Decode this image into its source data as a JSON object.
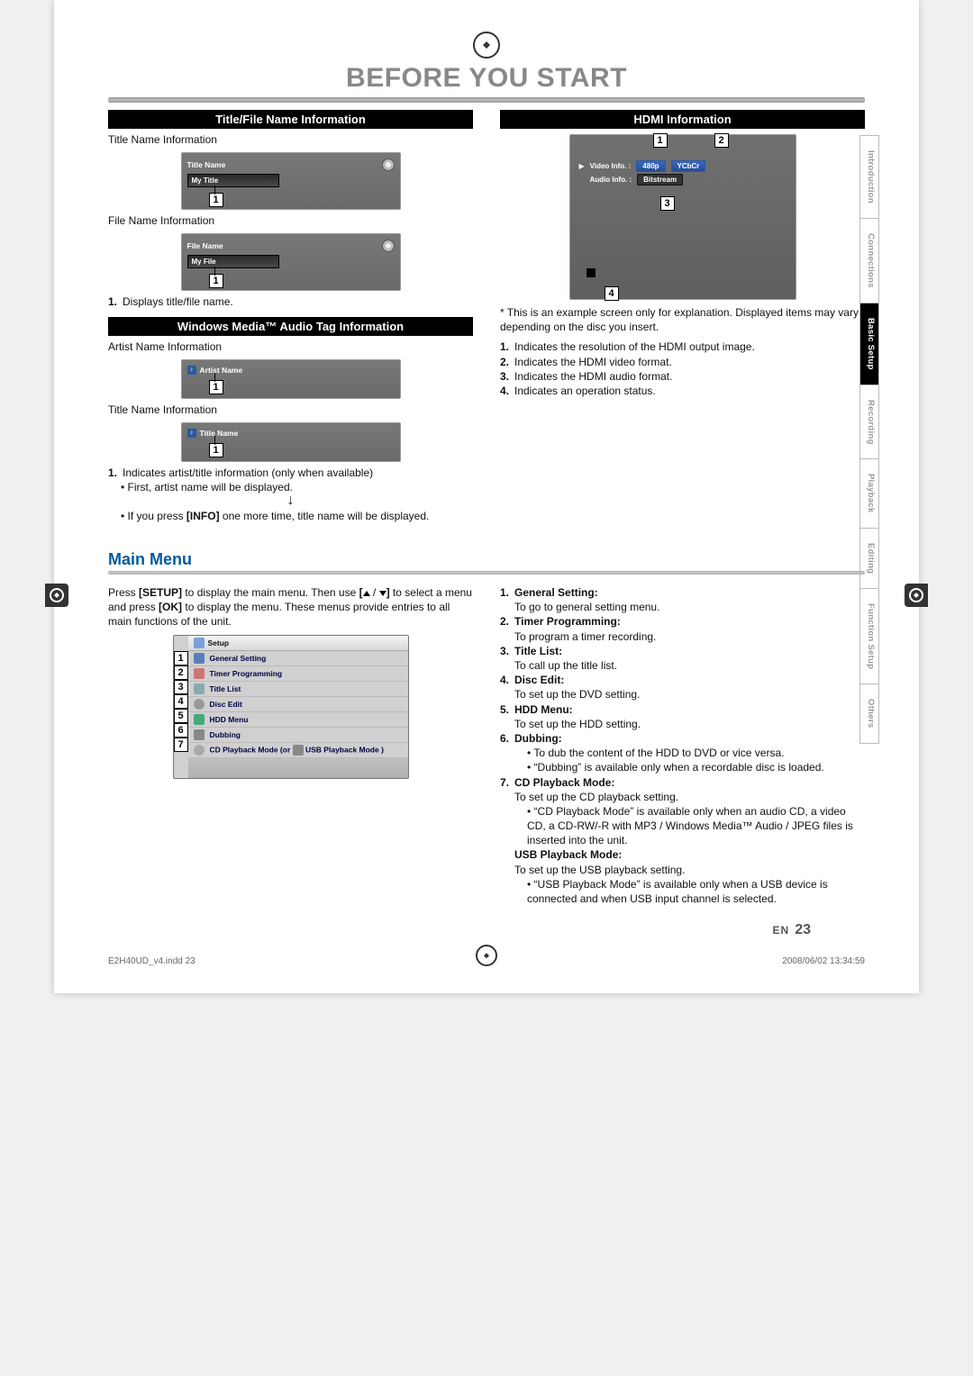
{
  "page": {
    "title": "BEFORE YOU START",
    "lang_code": "EN",
    "page_number": "23",
    "indd_file": "E2H40UD_v4.indd   23",
    "print_timestamp": "2008/06/02   13:34:59"
  },
  "tabs": [
    "Introduction",
    "Connections",
    "Basic Setup",
    "Recording",
    "Playback",
    "Editing",
    "Function Setup",
    "Others"
  ],
  "active_tab": "Basic Setup",
  "left": {
    "title_file_bar": "Title/File Name Information",
    "title_info_label": "Title Name Information",
    "shot_title_header": "Title Name",
    "shot_title_value": "My Title",
    "file_info_label": "File Name Information",
    "shot_file_header": "File Name",
    "shot_file_value": "My File",
    "callout_1_text": "Displays title/file name.",
    "wma_bar": "Windows Media™ Audio Tag Information",
    "artist_label": "Artist Name Information",
    "shot_artist_header": "Artist Name",
    "title2_label": "Title Name Information",
    "shot_title2_header": "Title Name",
    "wma_1_text": "Indicates artist/title information (only when available)",
    "wma_bullet_a": "First, artist name will be displayed.",
    "wma_bullet_b_pre": "If you press ",
    "wma_bullet_b_key": "[INFO]",
    "wma_bullet_b_post": " one more time, title name will be displayed."
  },
  "right": {
    "hdmi_bar": "HDMI Information",
    "hdmi_video_label": "Video Info.   :",
    "hdmi_video_res": "480p",
    "hdmi_video_fmt": "YCbCr",
    "hdmi_audio_label": "Audio Info.   :",
    "hdmi_audio_fmt": "Bitstream",
    "hdmi_note": "This is an example screen only for explanation. Displayed items may vary depending on the disc you insert.",
    "hdmi_items": [
      "Indicates the resolution of the HDMI output image.",
      "Indicates the HDMI video format.",
      "Indicates the HDMI audio format.",
      "Indicates an operation status."
    ]
  },
  "main_menu": {
    "heading": "Main Menu",
    "intro_a": "Press ",
    "intro_setup": "[SETUP]",
    "intro_b": " to display the main menu. Then use ",
    "intro_c": " to select a menu and press ",
    "intro_ok": "[OK]",
    "intro_d": " to display the menu. These menus provide entries to all main functions of the unit.",
    "arrow_hint": "[ ▲ / ▼ ]",
    "setup_title": "Setup",
    "items": [
      "General Setting",
      "Timer Programming",
      "Title List",
      "Disc Edit",
      "HDD Menu",
      "Dubbing"
    ],
    "item7_a": "CD Playback Mode",
    "item7_or": "  (or ",
    "item7_b": "USB Playback Mode",
    "item7_close": "  )",
    "glossary": [
      {
        "t": "General Setting:",
        "d": "To go to general setting menu."
      },
      {
        "t": "Timer Programming:",
        "d": "To program a timer recording."
      },
      {
        "t": "Title List:",
        "d": "To call up the title list."
      },
      {
        "t": "Disc Edit:",
        "d": "To set up the DVD setting."
      },
      {
        "t": "HDD Menu:",
        "d": "To set up the HDD setting."
      }
    ],
    "dubbing_t": "Dubbing:",
    "dubbing_b1": "To dub the content of the HDD to DVD or vice versa.",
    "dubbing_b2": "“Dubbing” is available only when a recordable disc is loaded.",
    "cd_t": "CD Playback Mode:",
    "cd_d": "To set up the CD playback setting.",
    "cd_b": "“CD Playback Mode” is available only when an audio CD, a video CD, a CD-RW/-R with MP3 / Windows Media™ Audio / JPEG files is inserted into the unit.",
    "usb_t": "USB Playback Mode:",
    "usb_d": "To set up the USB playback setting.",
    "usb_b": "“USB Playback Mode” is available only when a USB device is connected and when USB input channel is selected."
  }
}
